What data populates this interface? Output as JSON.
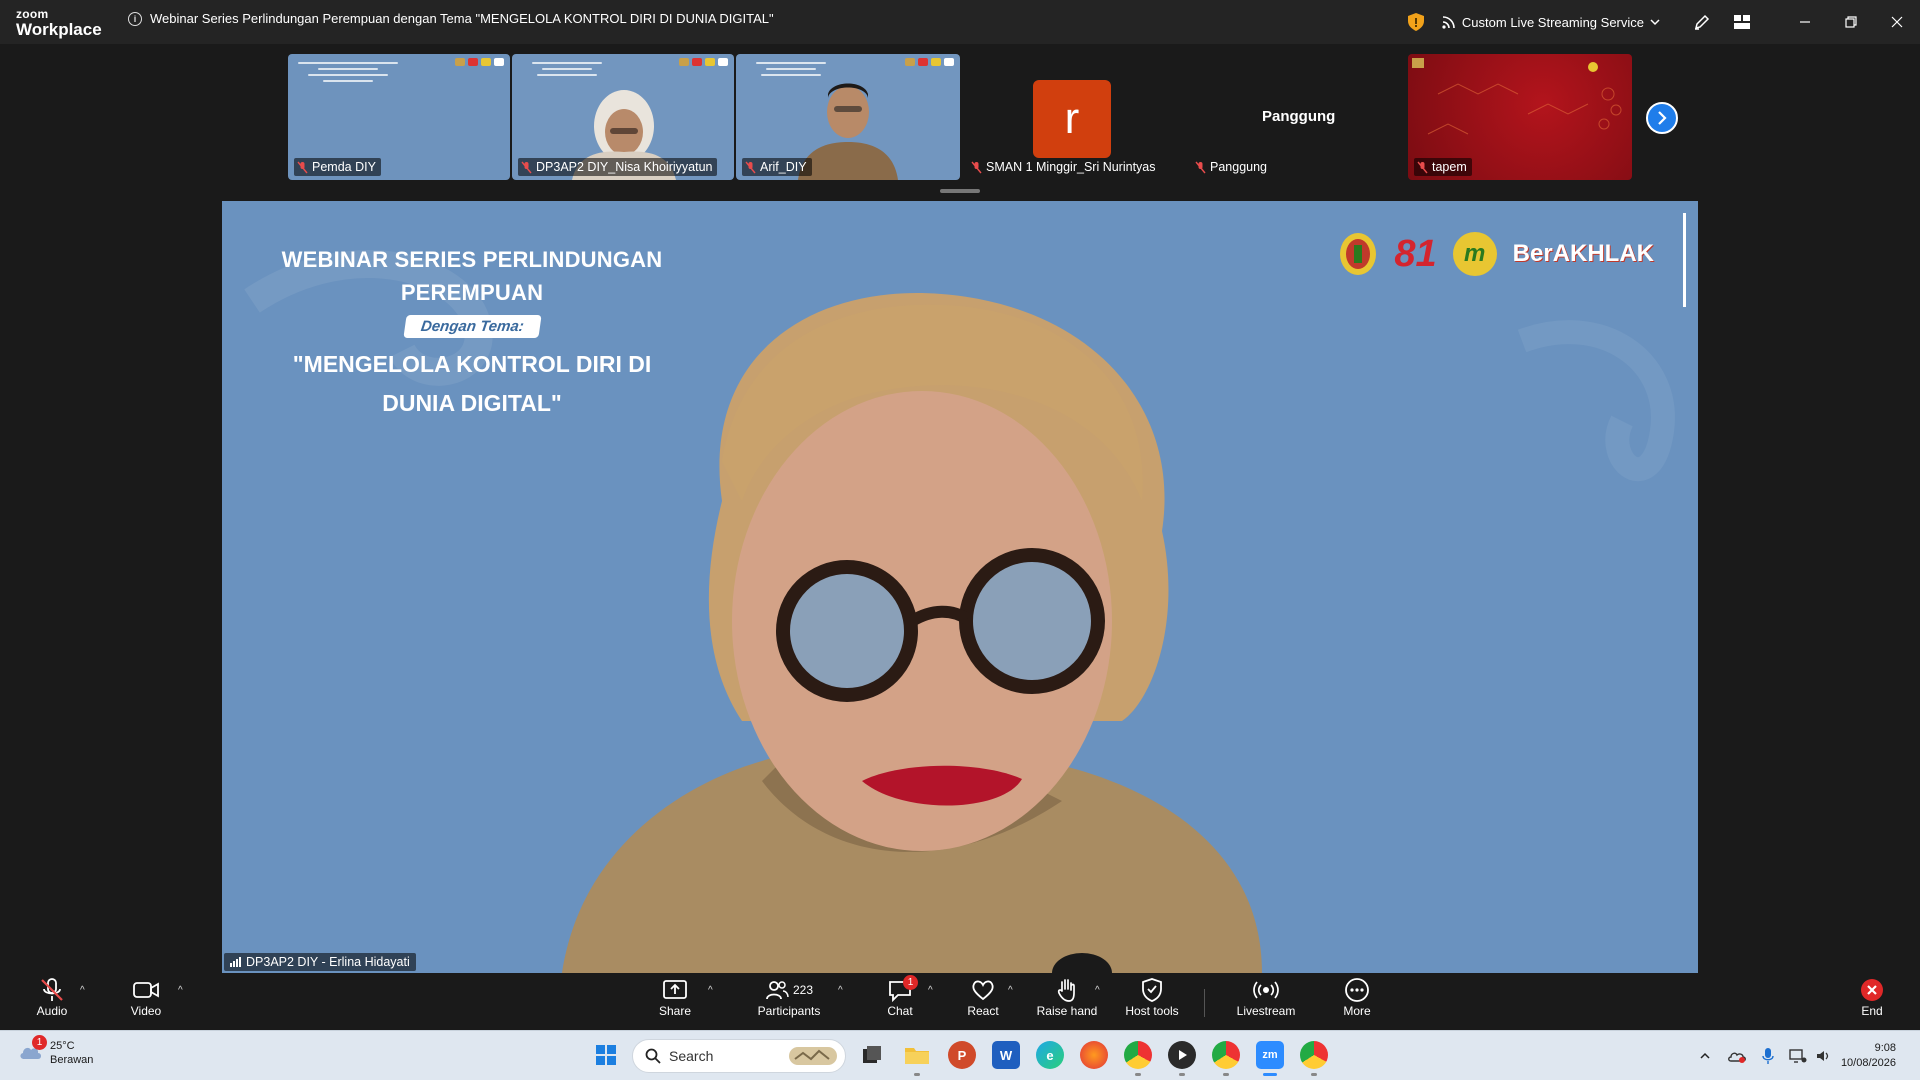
{
  "app": {
    "brand_top": "zoom",
    "brand_bottom": "Workplace"
  },
  "meeting": {
    "title": "Webinar Series Perlindungan Perempuan dengan Tema \"MENGELOLA KONTROL DIRI DI DUNIA DIGITAL\""
  },
  "titlebar": {
    "stream_label": "Custom Live Streaming Service"
  },
  "thumbnails": [
    {
      "name": "Pemda DIY"
    },
    {
      "name": "DP3AP2 DIY_Nisa Khoiriyyatun"
    },
    {
      "name": "Arif_DIY"
    },
    {
      "name": "SMAN 1 Minggir_Sri Nurintyas",
      "avatar_letter": "r"
    },
    {
      "name": "Panggung",
      "center_label": "Panggung"
    },
    {
      "name": "tapem"
    }
  ],
  "slide": {
    "title_line1": "WEBINAR SERIES PERLINDUNGAN",
    "title_line2": "PEREMPUAN",
    "tema_label": "Dengan Tema:",
    "theme_line1": "\"MENGELOLA KONTROL DIRI DI",
    "theme_line2": "DUNIA DIGITAL\"",
    "logo_81": "81",
    "logo_m": "m",
    "logo_berakhlak": "BerAKHLAK"
  },
  "speaker": {
    "name": "DP3AP2 DIY - Erlina Hidayati"
  },
  "toolbar": {
    "audio": "Audio",
    "video": "Video",
    "share": "Share",
    "participants": "Participants",
    "participants_count": "223",
    "chat": "Chat",
    "chat_badge": "1",
    "react": "React",
    "raise_hand": "Raise hand",
    "host_tools": "Host tools",
    "livestream": "Livestream",
    "more": "More",
    "end": "End"
  },
  "taskbar": {
    "weather_temp": "25°C",
    "weather_desc": "Berawan",
    "weather_badge": "1",
    "search_placeholder": "Search",
    "time": "9:08",
    "date": "10/08/2026"
  },
  "colors": {
    "accent_blue": "#1f7dea",
    "slide_bg": "#6a92bf",
    "avatar_orange": "#d13f0e",
    "badge_red": "#e02828"
  }
}
